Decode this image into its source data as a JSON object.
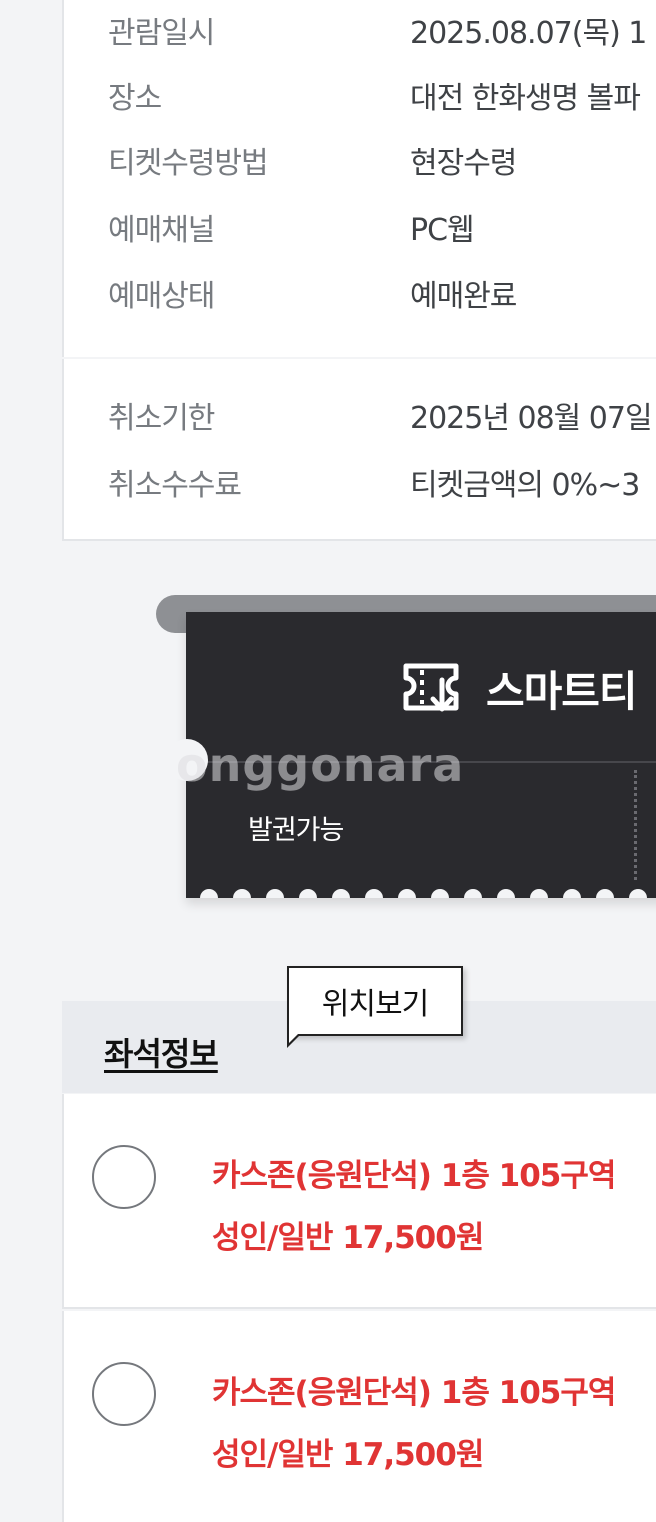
{
  "booking_info": [
    {
      "label": "관람일시",
      "value": "2025.08.07(목) 1"
    },
    {
      "label": "장소",
      "value": "대전 한화생명 볼파"
    },
    {
      "label": "티켓수령방법",
      "value": "현장수령"
    },
    {
      "label": "예매채널",
      "value": "PC웹"
    },
    {
      "label": "예매상태",
      "value": "예매완료"
    }
  ],
  "cancel_info": [
    {
      "label": "취소기한",
      "value": "2025년 08월 07일"
    },
    {
      "label": "취소수수료",
      "value": "티켓금액의 0%~3"
    }
  ],
  "ticket": {
    "title": "스마트티",
    "status": "발권가능",
    "icon": "ticket-download-icon"
  },
  "watermark": "onggonara",
  "seat_section": {
    "title": "좌석정보",
    "tooltip": "위치보기",
    "seats": [
      {
        "zone": "카스존(응원단석) 1층 105구역",
        "price": "성인/일반 17,500원"
      },
      {
        "zone": "카스존(응원단석) 1층 105구역",
        "price": "성인/일반 17,500원"
      }
    ]
  },
  "colors": {
    "accent_red": "#e03434",
    "ticket_bg": "#2a2a2e",
    "page_bg": "#f3f4f6"
  }
}
